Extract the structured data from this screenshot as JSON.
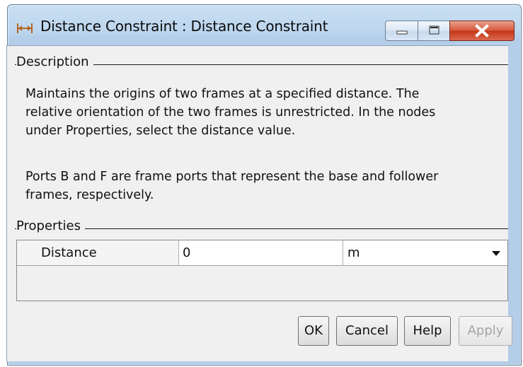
{
  "window": {
    "title": "Distance Constraint : Distance Constraint"
  },
  "description": {
    "label": "Description",
    "paragraph1_lines": [
      "Maintains the origins of two frames at a specified distance. The",
      "relative orientation of the two frames is unrestricted. In the nodes",
      "under Properties, select the distance value."
    ],
    "paragraph2_lines": [
      "Ports B and F are frame ports that represent the base and follower",
      "frames, respectively."
    ]
  },
  "properties": {
    "label": "Properties",
    "rows": [
      {
        "name": "Distance",
        "value": "0",
        "unit": "m"
      }
    ]
  },
  "buttons": {
    "ok": "OK",
    "cancel": "Cancel",
    "help": "Help",
    "apply": "Apply"
  }
}
